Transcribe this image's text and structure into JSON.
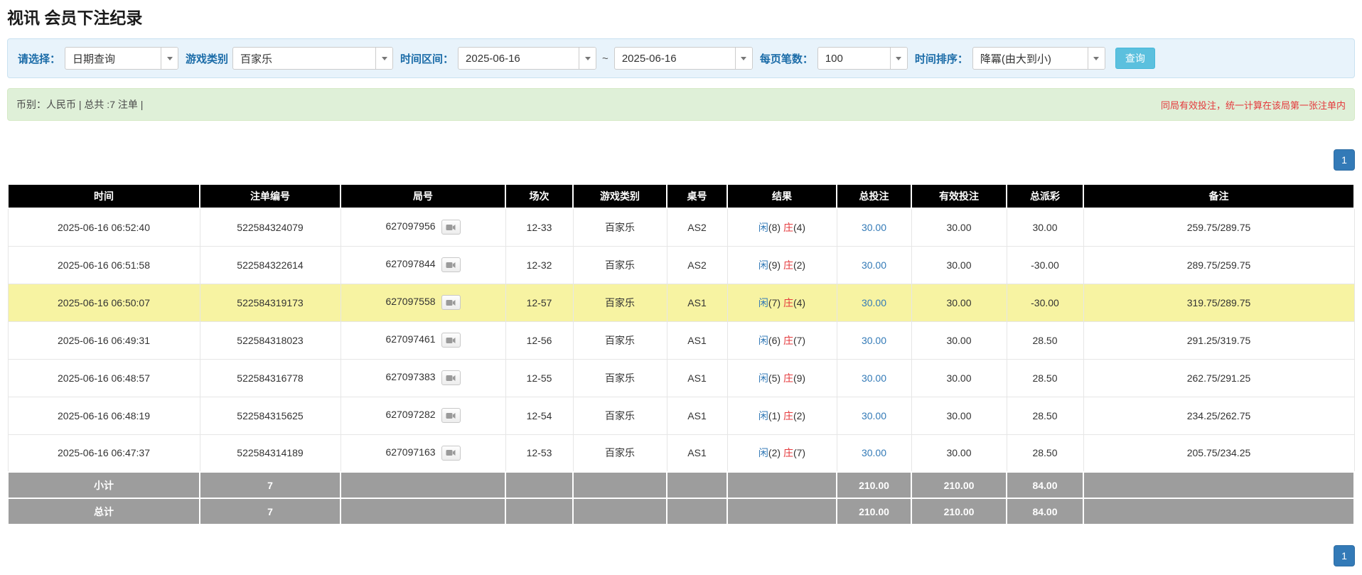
{
  "colors": {
    "accent_blue": "#337ab7",
    "query_button_blue": "#5bc0de",
    "filter_bar_bg": "#e8f3fb",
    "info_bar_bg": "#dff0d8",
    "table_header_bg": "#000000",
    "summary_row_bg": "#9d9d9d",
    "highlight_row_bg": "#f7f3a2",
    "negative_red": "#e4393c",
    "player_blue": "#337ab7",
    "banker_red": "#e4393c"
  },
  "page_title": "视讯 会员下注纪录",
  "filter": {
    "select_label": "请选择：",
    "select_value": "日期查询",
    "game_type_label": "游戏类别",
    "game_type_value": "百家乐",
    "time_range_label": "时间区间：",
    "date_from": "2025-06-16",
    "range_separator": "~",
    "date_to": "2025-06-16",
    "page_size_label": "每页笔数：",
    "page_size_value": "100",
    "sort_label": "时间排序：",
    "sort_value": "降冪(由大到小)",
    "query_button": "查询"
  },
  "info_bar": {
    "left_text": "币别：人民币 | 总共 :7 注单 |",
    "right_text": "同局有效投注，统一计算在该局第一张注单内"
  },
  "pagination": {
    "page": "1"
  },
  "table": {
    "headers": [
      "时间",
      "注单编号",
      "局号",
      "场次",
      "游戏类别",
      "桌号",
      "结果",
      "总投注",
      "有效投注",
      "总派彩",
      "备注"
    ],
    "rows": [
      {
        "time": "2025-06-16 06:52:40",
        "bet_id": "522584324079",
        "round_id": "627097956",
        "session": "12-33",
        "game": "百家乐",
        "table_no": "AS2",
        "result": {
          "player": "闲(8)",
          "banker": "庄(4)"
        },
        "total_bet": "30.00",
        "valid_bet": "30.00",
        "payout": "30.00",
        "remark": "259.75/289.75",
        "highlight": false
      },
      {
        "time": "2025-06-16 06:51:58",
        "bet_id": "522584322614",
        "round_id": "627097844",
        "session": "12-32",
        "game": "百家乐",
        "table_no": "AS2",
        "result": {
          "player": "闲(9)",
          "banker": "庄(2)"
        },
        "total_bet": "30.00",
        "valid_bet": "30.00",
        "payout": "-30.00",
        "remark": "289.75/259.75",
        "highlight": false
      },
      {
        "time": "2025-06-16 06:50:07",
        "bet_id": "522584319173",
        "round_id": "627097558",
        "session": "12-57",
        "game": "百家乐",
        "table_no": "AS1",
        "result": {
          "player": "闲(7)",
          "banker": "庄(4)"
        },
        "total_bet": "30.00",
        "valid_bet": "30.00",
        "payout": "-30.00",
        "remark": "319.75/289.75",
        "highlight": true
      },
      {
        "time": "2025-06-16 06:49:31",
        "bet_id": "522584318023",
        "round_id": "627097461",
        "session": "12-56",
        "game": "百家乐",
        "table_no": "AS1",
        "result": {
          "player": "闲(6)",
          "banker": "庄(7)"
        },
        "total_bet": "30.00",
        "valid_bet": "30.00",
        "payout": "28.50",
        "remark": "291.25/319.75",
        "highlight": false
      },
      {
        "time": "2025-06-16 06:48:57",
        "bet_id": "522584316778",
        "round_id": "627097383",
        "session": "12-55",
        "game": "百家乐",
        "table_no": "AS1",
        "result": {
          "player": "闲(5)",
          "banker": "庄(9)"
        },
        "total_bet": "30.00",
        "valid_bet": "30.00",
        "payout": "28.50",
        "remark": "262.75/291.25",
        "highlight": false
      },
      {
        "time": "2025-06-16 06:48:19",
        "bet_id": "522584315625",
        "round_id": "627097282",
        "session": "12-54",
        "game": "百家乐",
        "table_no": "AS1",
        "result": {
          "player": "闲(1)",
          "banker": "庄(2)"
        },
        "total_bet": "30.00",
        "valid_bet": "30.00",
        "payout": "28.50",
        "remark": "234.25/262.75",
        "highlight": false
      },
      {
        "time": "2025-06-16 06:47:37",
        "bet_id": "522584314189",
        "round_id": "627097163",
        "session": "12-53",
        "game": "百家乐",
        "table_no": "AS1",
        "result": {
          "player": "闲(2)",
          "banker": "庄(7)"
        },
        "total_bet": "30.00",
        "valid_bet": "30.00",
        "payout": "28.50",
        "remark": "205.75/234.25",
        "highlight": false
      }
    ],
    "subtotal": {
      "label": "小计",
      "count": "7",
      "total_bet": "210.00",
      "valid_bet": "210.00",
      "payout": "84.00"
    },
    "total": {
      "label": "总计",
      "count": "7",
      "total_bet": "210.00",
      "valid_bet": "210.00",
      "payout": "84.00"
    }
  }
}
